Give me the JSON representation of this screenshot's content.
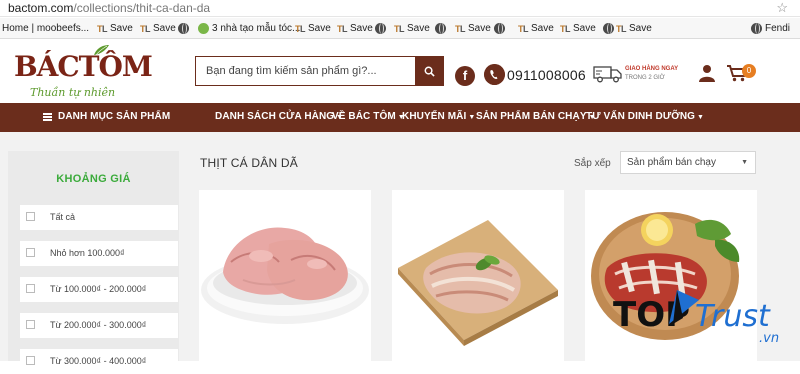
{
  "browser": {
    "url_host": "bactom.com",
    "url_path": "/collections/thit-ca-dan-da"
  },
  "bookmarks": [
    {
      "label": "Home | moobeefs...",
      "icon": "grid-icon"
    },
    {
      "label": "Save",
      "icon": "tl-icon"
    },
    {
      "label": "Save",
      "icon": "tl-icon"
    },
    {
      "label": "",
      "icon": "globe-icon"
    },
    {
      "label": "3 nhà tạo mẫu tóc...",
      "icon": "leaf-icon"
    },
    {
      "label": "Save",
      "icon": "tl-icon"
    },
    {
      "label": "Save",
      "icon": "tl-icon"
    },
    {
      "label": "",
      "icon": "globe-icon"
    },
    {
      "label": "Save",
      "icon": "tl-icon"
    },
    {
      "label": "",
      "icon": "globe-icon"
    },
    {
      "label": "Save",
      "icon": "tl-icon"
    },
    {
      "label": "",
      "icon": "globe-icon"
    },
    {
      "label": "Save",
      "icon": "tl-icon"
    },
    {
      "label": "Save",
      "icon": "tl-icon"
    },
    {
      "label": "",
      "icon": "globe-icon"
    },
    {
      "label": "Save",
      "icon": "tl-icon"
    },
    {
      "label": "Fendi",
      "icon": "globe-icon"
    }
  ],
  "header": {
    "logo_main": "BÁCTÔM",
    "logo_sub": "Thuần tự nhiên",
    "search_placeholder": "Bạn đang tìm kiếm sản phẩm gì?...",
    "facebook": "f",
    "phone": "0911008006",
    "shipping_line1": "GIAO HÀNG NGAY",
    "shipping_line2": "TRONG 2 GIỜ",
    "cart_count": "0"
  },
  "nav": {
    "menu_label": "DANH MỤC SẢN PHẨM",
    "items": [
      "DANH SÁCH CỬA HÀNG",
      "VỀ BÁC TÔM",
      "KHUYẾN MÃI",
      "SẢN PHẨM BÁN CHẠY",
      "TƯ VẤN DINH DƯỠNG"
    ]
  },
  "sidebar": {
    "title": "KHOẢNG GIÁ",
    "filters": [
      "Tất cả",
      "Nhỏ hơn 100.000₫",
      "Từ 100.000₫ - 200.000₫",
      "Từ 200.000₫ - 300.000₫",
      "Từ 300.000₫ - 400.000₫"
    ]
  },
  "main": {
    "page_title": "THỊT CÁ DÂN DÃ",
    "sort_label": "Sắp xếp",
    "sort_value": "Sản phẩm bán chạy"
  },
  "watermark": {
    "brand": "TOPTrust",
    "domain": ".vn"
  },
  "colors": {
    "brand_brown": "#6b2d1c",
    "accent_green": "#3cab3c",
    "badge_orange": "#e67e22"
  }
}
